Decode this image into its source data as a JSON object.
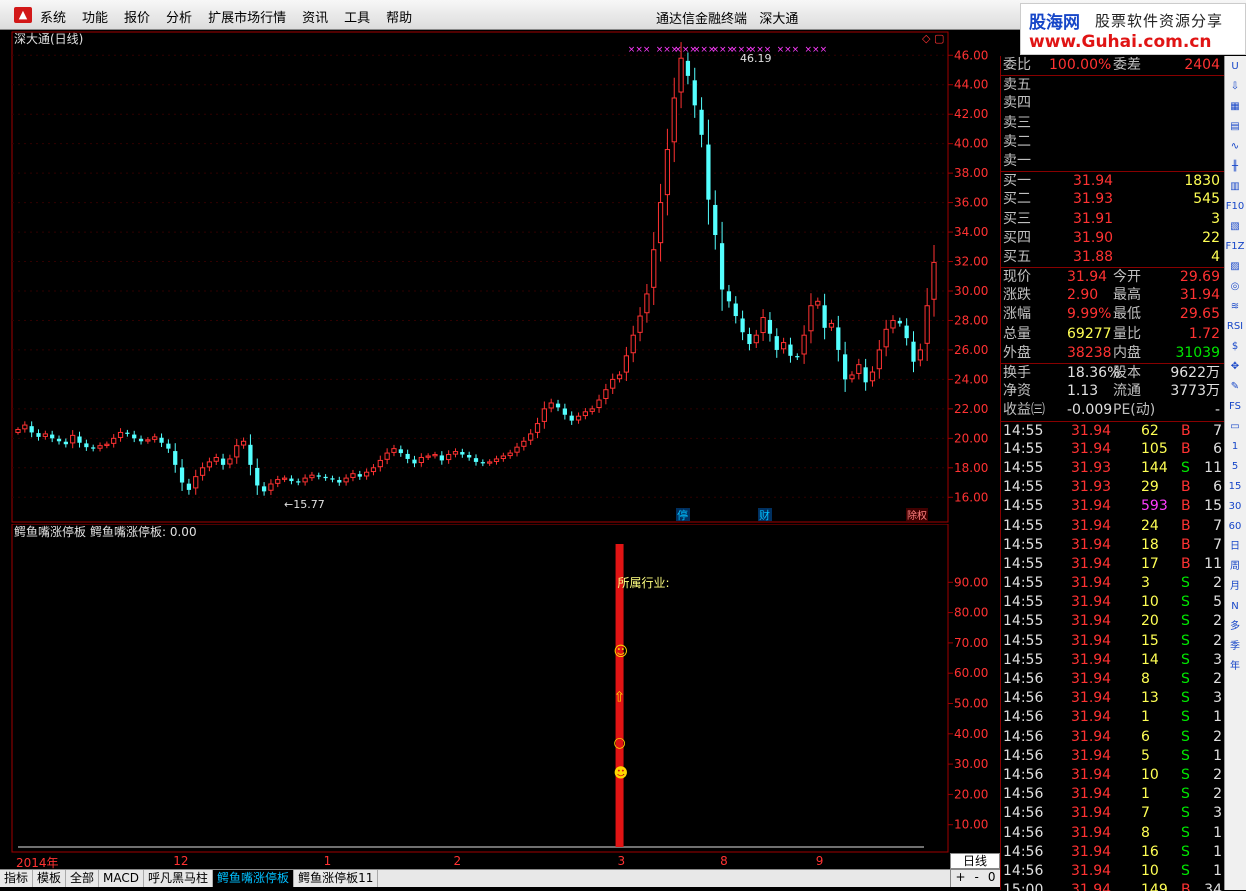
{
  "menu": {
    "items": [
      "系统",
      "功能",
      "报价",
      "分析",
      "扩展市场行情",
      "资讯",
      "工具",
      "帮助"
    ],
    "app_title": "通达信金融终端",
    "stock_name": "深大通"
  },
  "banner": {
    "site_name": "股海网",
    "slogan": "股票软件资源分享",
    "url": "www.Guhai.com.cn"
  },
  "chart_title": "深大通(日线)",
  "indicator_title": "鳄鱼嘴涨停板",
  "indicator_value_label": "鳄鱼嘴涨停板: 0.00",
  "industry_label": "所属行业:",
  "markers": {
    "stop": "停",
    "finance": "财",
    "dividend": "除权",
    "peak_label": "46.19",
    "low_label": "←15.77"
  },
  "chart_data": {
    "type": "candlestick",
    "title": "深大通(日线)",
    "ylim": [
      15.0,
      46.9
    ],
    "y_ticks": [
      "46.00",
      "44.00",
      "42.00",
      "40.00",
      "38.00",
      "36.00",
      "34.00",
      "32.00",
      "30.00",
      "28.00",
      "26.00",
      "24.00",
      "22.00",
      "20.00",
      "18.00",
      "16.00"
    ],
    "peak": 46.19,
    "low": 15.77,
    "indicator_ylim": [
      0,
      100
    ],
    "indicator_ticks": [
      "90.00",
      "80.00",
      "70.00",
      "60.00",
      "50.00",
      "40.00",
      "30.00",
      "20.00",
      "10.00"
    ],
    "closes": [
      20.6,
      20.9,
      20.4,
      20.1,
      20.3,
      20.0,
      19.8,
      19.6,
      20.2,
      19.7,
      19.4,
      19.3,
      19.5,
      19.6,
      20.0,
      20.4,
      20.3,
      20.0,
      19.8,
      19.9,
      20.1,
      19.7,
      19.3,
      18.2,
      17.0,
      16.5,
      17.4,
      18.0,
      18.4,
      18.7,
      18.2,
      18.6,
      19.5,
      19.8,
      18.2,
      16.8,
      16.4,
      16.9,
      17.2,
      17.3,
      17.1,
      17.0,
      17.3,
      17.5,
      17.4,
      17.3,
      17.2,
      17.0,
      17.3,
      17.6,
      17.4,
      17.7,
      18.0,
      18.5,
      19.0,
      19.3,
      19.0,
      18.6,
      18.3,
      18.7,
      18.8,
      18.9,
      18.5,
      18.9,
      19.1,
      18.9,
      18.7,
      18.4,
      18.3,
      18.4,
      18.6,
      18.8,
      19.0,
      19.4,
      19.8,
      20.3,
      21.0,
      22.0,
      22.4,
      22.1,
      21.6,
      21.2,
      21.5,
      21.8,
      22.0,
      22.6,
      23.3,
      24.0,
      24.3,
      25.6,
      27.0,
      28.3,
      29.8,
      32.8,
      36.0,
      39.6,
      43.1,
      45.8,
      44.6,
      42.6,
      40.6,
      36.2,
      33.8,
      30.1,
      29.3,
      28.3,
      27.2,
      26.4,
      27.0,
      28.2,
      27.1,
      26.0,
      26.5,
      25.6,
      25.5,
      27.0,
      29.0,
      29.3,
      27.5,
      27.8,
      26.0,
      24.0,
      24.3,
      25.0,
      23.8,
      24.5,
      26.0,
      27.4,
      28.0,
      27.8,
      26.8,
      25.2,
      26.0,
      29.0,
      31.94
    ],
    "limit_up_marks_x": [
      0.66,
      0.69,
      0.71,
      0.73,
      0.75,
      0.77,
      0.79,
      0.82,
      0.85
    ],
    "indicator_bar": {
      "value": 100,
      "index": 88,
      "event_levels": [
        65,
        50,
        35,
        25
      ]
    }
  },
  "date_axis": [
    {
      "label": "2014年",
      "index": 0
    },
    {
      "label": "12",
      "index": 23
    },
    {
      "label": "1",
      "index": 45
    },
    {
      "label": "2",
      "index": 64
    },
    {
      "label": "3",
      "index": 88
    },
    {
      "label": "8",
      "index": 103
    },
    {
      "label": "9",
      "index": 117
    }
  ],
  "quote": {
    "weibi": {
      "label": "委比",
      "value": "100.00%",
      "label2": "委差",
      "value2": "2404"
    },
    "sell": [
      {
        "label": "卖五"
      },
      {
        "label": "卖四"
      },
      {
        "label": "卖三"
      },
      {
        "label": "卖二"
      },
      {
        "label": "卖一"
      }
    ],
    "buy": [
      {
        "label": "买一",
        "price": "31.94",
        "vol": "1830"
      },
      {
        "label": "买二",
        "price": "31.93",
        "vol": "545"
      },
      {
        "label": "买三",
        "price": "31.91",
        "vol": "3"
      },
      {
        "label": "买四",
        "price": "31.90",
        "vol": "22"
      },
      {
        "label": "买五",
        "price": "31.88",
        "vol": "4"
      }
    ],
    "stats": [
      {
        "l1": "现价",
        "v1": "31.94",
        "c1": "red",
        "l2": "今开",
        "v2": "29.69",
        "c2": "red"
      },
      {
        "l1": "涨跌",
        "v1": "2.90",
        "c1": "red",
        "l2": "最高",
        "v2": "31.94",
        "c2": "red"
      },
      {
        "l1": "涨幅",
        "v1": "9.99%",
        "c1": "red",
        "l2": "最低",
        "v2": "29.65",
        "c2": "red"
      },
      {
        "l1": "总量",
        "v1": "69277",
        "c1": "yel",
        "l2": "量比",
        "v2": "1.72",
        "c2": "red"
      },
      {
        "l1": "外盘",
        "v1": "38238",
        "c1": "red",
        "l2": "内盘",
        "v2": "31039",
        "c2": "grn"
      }
    ],
    "stats2": [
      {
        "l1": "换手",
        "v1": "18.36%",
        "l2": "股本",
        "v2": "9622万"
      },
      {
        "l1": "净资",
        "v1": "1.13",
        "l2": "流通",
        "v2": "3773万"
      },
      {
        "l1": "收益㈢",
        "v1": "-0.009",
        "l2": "PE(动)",
        "v2": "-"
      }
    ],
    "ticks": [
      {
        "t": "14:55",
        "p": "31.94",
        "v": "62",
        "s": "B",
        "n": "7"
      },
      {
        "t": "14:55",
        "p": "31.94",
        "v": "105",
        "s": "B",
        "n": "6"
      },
      {
        "t": "14:55",
        "p": "31.93",
        "v": "144",
        "s": "S",
        "n": "11"
      },
      {
        "t": "14:55",
        "p": "31.93",
        "v": "29",
        "s": "B",
        "n": "6"
      },
      {
        "t": "14:55",
        "p": "31.94",
        "v": "593",
        "s": "B",
        "n": "15"
      },
      {
        "t": "14:55",
        "p": "31.94",
        "v": "24",
        "s": "B",
        "n": "7"
      },
      {
        "t": "14:55",
        "p": "31.94",
        "v": "18",
        "s": "B",
        "n": "7"
      },
      {
        "t": "14:55",
        "p": "31.94",
        "v": "17",
        "s": "B",
        "n": "11"
      },
      {
        "t": "14:55",
        "p": "31.94",
        "v": "3",
        "s": "S",
        "n": "2"
      },
      {
        "t": "14:55",
        "p": "31.94",
        "v": "10",
        "s": "S",
        "n": "5"
      },
      {
        "t": "14:55",
        "p": "31.94",
        "v": "20",
        "s": "S",
        "n": "2"
      },
      {
        "t": "14:55",
        "p": "31.94",
        "v": "15",
        "s": "S",
        "n": "2"
      },
      {
        "t": "14:55",
        "p": "31.94",
        "v": "14",
        "s": "S",
        "n": "3"
      },
      {
        "t": "14:56",
        "p": "31.94",
        "v": "8",
        "s": "S",
        "n": "2"
      },
      {
        "t": "14:56",
        "p": "31.94",
        "v": "13",
        "s": "S",
        "n": "3"
      },
      {
        "t": "14:56",
        "p": "31.94",
        "v": "1",
        "s": "S",
        "n": "1"
      },
      {
        "t": "14:56",
        "p": "31.94",
        "v": "6",
        "s": "S",
        "n": "2"
      },
      {
        "t": "14:56",
        "p": "31.94",
        "v": "5",
        "s": "S",
        "n": "1"
      },
      {
        "t": "14:56",
        "p": "31.94",
        "v": "10",
        "s": "S",
        "n": "2"
      },
      {
        "t": "14:56",
        "p": "31.94",
        "v": "1",
        "s": "S",
        "n": "2"
      },
      {
        "t": "14:56",
        "p": "31.94",
        "v": "7",
        "s": "S",
        "n": "3"
      },
      {
        "t": "14:56",
        "p": "31.94",
        "v": "8",
        "s": "S",
        "n": "1"
      },
      {
        "t": "14:56",
        "p": "31.94",
        "v": "16",
        "s": "S",
        "n": "1"
      },
      {
        "t": "14:56",
        "p": "31.94",
        "v": "10",
        "s": "S",
        "n": "1"
      },
      {
        "t": "15:00",
        "p": "31.94",
        "v": "149",
        "s": "B",
        "n": "34"
      }
    ]
  },
  "tabs": [
    "指标",
    "模板",
    "全部",
    "MACD",
    "呼凡黑马柱",
    "鳄鱼嘴涨停板",
    "鳄鱼涨停板11"
  ],
  "active_tab": "鳄鱼嘴涨停板",
  "period_label": "日线",
  "zoom": {
    "plus": "+",
    "minus": "-",
    "zero": "0"
  },
  "toolbar_right": [
    "U",
    "⇩",
    "▦",
    "▤",
    "∿",
    "╫",
    "▥",
    "F10",
    "▧",
    "F1Z",
    "▨",
    "◎",
    "≋",
    "RSI",
    "$",
    "✥",
    "✎",
    "FS",
    "▭",
    "1",
    "5",
    "15",
    "30",
    "60",
    "日",
    "周",
    "月",
    "N",
    "多",
    "季",
    "年"
  ]
}
